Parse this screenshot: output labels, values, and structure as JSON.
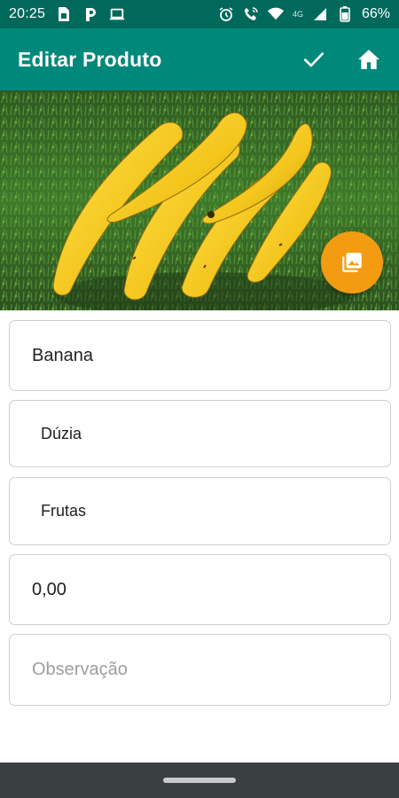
{
  "status_bar": {
    "time": "20:25",
    "network_label": "4G",
    "battery_text": "66%",
    "icons": [
      "sim-card-icon",
      "p-app-icon",
      "laptop-icon",
      "alarm-icon",
      "wifi-calling-icon",
      "wifi-icon",
      "signal-icon",
      "battery-icon"
    ]
  },
  "app_bar": {
    "title": "Editar Produto",
    "actions": [
      "check-icon",
      "home-icon"
    ],
    "color": "#00897b",
    "status_color": "#00695c"
  },
  "image": {
    "subject": "bananas on grass",
    "fab_icon": "gallery-icon",
    "fab_color": "#f39c12"
  },
  "form": {
    "name_value": "Banana",
    "unit_value": "Dúzia",
    "category_value": "Frutas",
    "price_value": "0,00",
    "notes_placeholder": "Observação"
  }
}
